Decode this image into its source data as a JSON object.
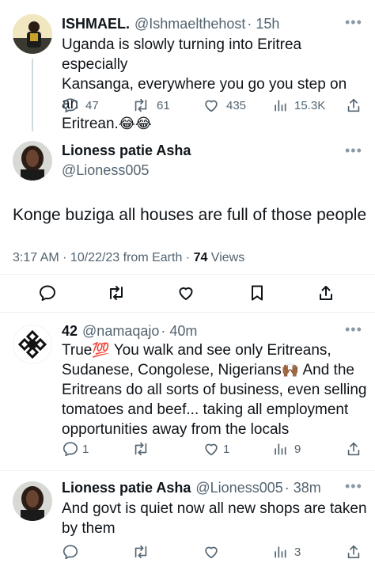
{
  "tweet1": {
    "name": "ISHMAEL.",
    "handle": "@Ishmaelthehost",
    "time": "· 15h",
    "lines": [
      "Uganda is slowly turning into Eritrea especially",
      "Kansanga, everywhere you go you step on an",
      "Eritrean."
    ],
    "emoji": "😂😂",
    "replies": "47",
    "retweets": "61",
    "likes": "435",
    "views": "15.3K"
  },
  "main_tweet": {
    "name": "Lioness patie Asha",
    "handle": "@Lioness005",
    "text": "Konge buziga all houses are full of those people",
    "timestamp": "3:17 AM · 10/22/23 from Earth · ",
    "views_count": "74",
    "views_label": " Views"
  },
  "reply1": {
    "name": "42",
    "handle": "@namaqajo",
    "time": "· 40m",
    "line1_a": "True",
    "line1_emoji": "💯",
    "line1_b": " You walk and see only Eritreans,",
    "line2_a": "Sudanese, Congolese, Nigerians",
    "line2_emoji": "🙌🏾",
    "line2_b": " And the",
    "line3": "Eritreans do all sorts of business, even selling",
    "line4": "tomatoes and beef... taking all employment",
    "line5": "opportunities away from the locals",
    "replies": "1",
    "likes": "1",
    "views": "9"
  },
  "reply2": {
    "name": "Lioness patie Asha",
    "handle": "@Lioness005",
    "time": "· 38m",
    "lines": [
      "And govt is quiet now all new shops are taken",
      "by them"
    ],
    "views": "3"
  },
  "more_glyph": "•••",
  "colors": {
    "text": "#0f1419",
    "secondary": "#536471",
    "divider": "#eff3f4"
  },
  "icons": [
    "reply-icon",
    "retweet-icon",
    "like-icon",
    "views-icon",
    "share-icon",
    "bookmark-icon",
    "more-icon"
  ]
}
